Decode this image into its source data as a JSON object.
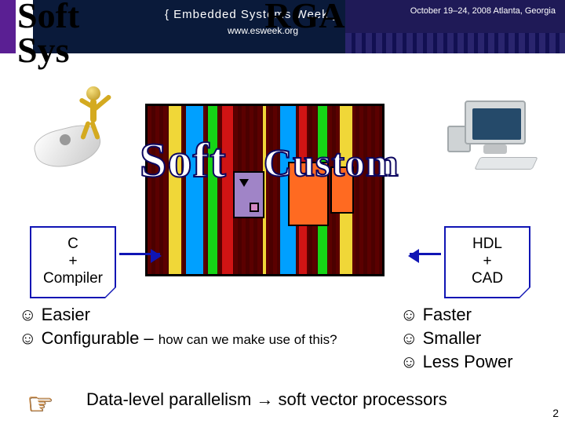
{
  "banner": {
    "line1": "{ Embedded Systems Week }",
    "line2": "www.esweek.org",
    "dateloc": "October 19–24, 2008  Atlanta, Georgia"
  },
  "title_line1": "Soft",
  "title_line2": "Sys",
  "title_suffix": "RGA",
  "wordart": {
    "soft": "Soft",
    "custom": "Custom"
  },
  "note_left": {
    "l1": "C",
    "l2": "+",
    "l3": "Compiler"
  },
  "note_right": {
    "l1": "HDL",
    "l2": "+",
    "l3": "CAD"
  },
  "bullets_left": {
    "b1": "☺ Easier",
    "b2_main": "☺ Configurable – ",
    "b2_sub": "how can we make use of this?"
  },
  "bullets_right": {
    "b1": "☺ Faster",
    "b2": "☺ Smaller",
    "b3": "☺ Less Power"
  },
  "bottom": "Data-level parallelism → soft vector processors",
  "pointer_icon": "☞",
  "page": "2"
}
